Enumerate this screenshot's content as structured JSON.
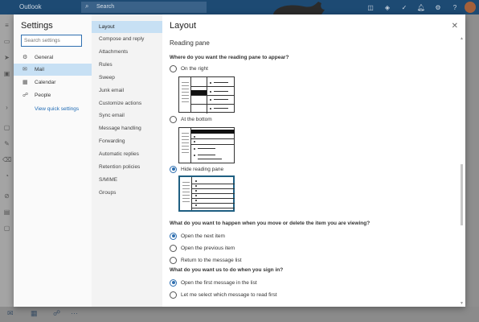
{
  "app": {
    "brand": "Outlook",
    "search_placeholder": "Search"
  },
  "modal": {
    "settings_title": "Settings",
    "search_placeholder": "Search settings",
    "categories": [
      {
        "label": "General",
        "icon": "gear-icon"
      },
      {
        "label": "Mail",
        "icon": "mail-icon",
        "active": true
      },
      {
        "label": "Calendar",
        "icon": "calendar-icon"
      },
      {
        "label": "People",
        "icon": "people-icon"
      }
    ],
    "quick_settings_link": "View quick settings",
    "mail_sections": [
      "Layout",
      "Compose and reply",
      "Attachments",
      "Rules",
      "Sweep",
      "Junk email",
      "Customize actions",
      "Sync email",
      "Message handling",
      "Forwarding",
      "Automatic replies",
      "Retention policies",
      "S/MIME",
      "Groups"
    ],
    "active_section": "Layout",
    "page_title": "Layout",
    "reading_pane": {
      "heading": "Reading pane",
      "question": "Where do you want the reading pane to appear?",
      "options": [
        "On the right",
        "At the bottom",
        "Hide reading pane"
      ],
      "selected": "Hide reading pane"
    },
    "move_delete": {
      "question": "What do you want to happen when you move or delete the item you are viewing?",
      "options": [
        "Open the next item",
        "Open the previous item",
        "Return to the message list"
      ],
      "selected": "Open the next item"
    },
    "sign_in": {
      "question": "What do you want us to do when you sign in?",
      "options": [
        "Open the first message in the list",
        "Let me select which message to read first"
      ],
      "selected": "Open the first message in the list"
    }
  },
  "colors": {
    "accent": "#2f6fb0",
    "active_nav": "#c7e0f4",
    "topbar": "#1d4a73"
  }
}
